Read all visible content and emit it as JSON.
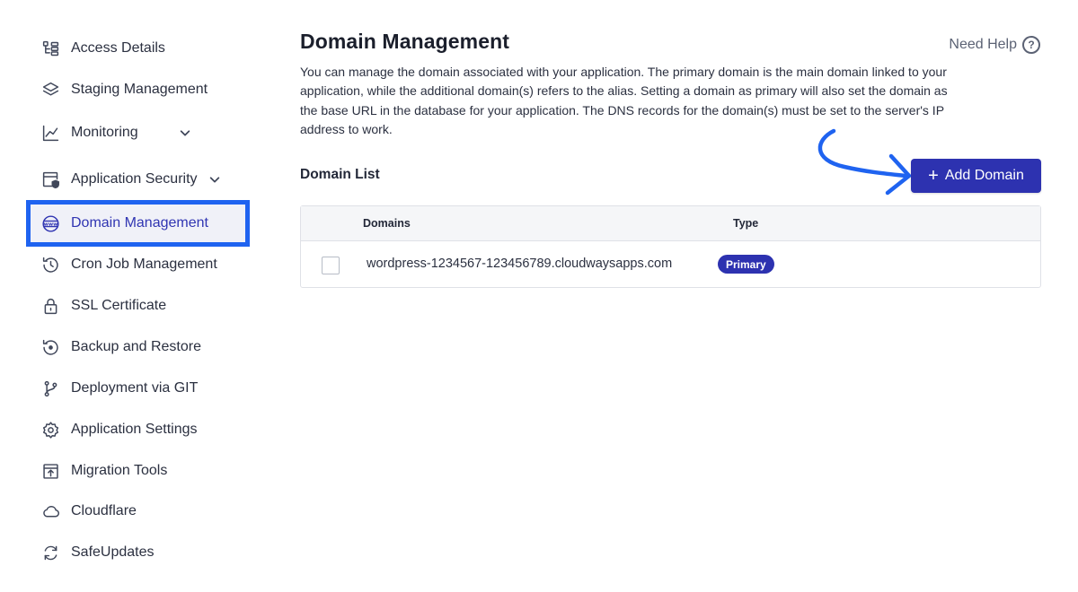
{
  "sidebar": {
    "items": [
      {
        "label": "Access Details",
        "icon": "access-details-icon"
      },
      {
        "label": "Staging Management",
        "icon": "layers-icon"
      },
      {
        "label": "Monitoring",
        "icon": "chart-line-icon",
        "expandable": true
      },
      {
        "label": "Application Security",
        "icon": "shield-window-icon",
        "expandable": true
      },
      {
        "label": "Domain Management",
        "icon": "www-globe-icon",
        "active": true
      },
      {
        "label": "Cron Job Management",
        "icon": "history-clock-icon"
      },
      {
        "label": "SSL Certificate",
        "icon": "lock-icon"
      },
      {
        "label": "Backup and Restore",
        "icon": "backup-restore-icon"
      },
      {
        "label": "Deployment via GIT",
        "icon": "git-branch-icon"
      },
      {
        "label": "Application Settings",
        "icon": "gear-icon"
      },
      {
        "label": "Migration Tools",
        "icon": "upload-box-icon"
      },
      {
        "label": "Cloudflare",
        "icon": "cloud-icon"
      },
      {
        "label": "SafeUpdates",
        "icon": "refresh-icon"
      }
    ]
  },
  "header": {
    "title": "Domain Management",
    "help_label": "Need Help",
    "help_symbol": "?",
    "description": "You can manage the domain associated with your application. The primary domain is the main domain linked to your application, while the additional domain(s) refers to the alias. Setting a domain as primary will also set the domain as the base URL in the database for your application. The DNS records for the domain(s) must be set to the server's IP address to work."
  },
  "domain_list": {
    "title": "Domain List",
    "add_button_label": "Add Domain",
    "add_button_symbol": "+",
    "columns": [
      "Domains",
      "Type"
    ],
    "rows": [
      {
        "domain": "wordpress-1234567-123456789.cloudwaysapps.com",
        "type": "Primary"
      }
    ]
  },
  "colors": {
    "accent": "#2d32b0",
    "highlight_border": "#1f63f0"
  }
}
